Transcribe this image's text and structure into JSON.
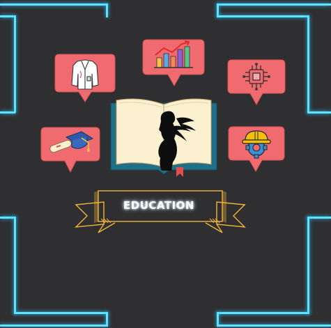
{
  "title": "EDUCATION",
  "colors": {
    "background": "#2f2f31",
    "neon_frame": "#29c6ff",
    "bubble_fill": "#ef6b6f",
    "banner_outline": "#f2b53a",
    "book_cover": "#1e6f87",
    "book_pages": "#fbf0cf"
  },
  "icons": [
    "lab-coat-icon",
    "bar-chart-icon",
    "microchip-icon",
    "graduation-cap-icon",
    "hard-hat-gear-icon",
    "woman-silhouette-icon",
    "bookmark-icon"
  ]
}
